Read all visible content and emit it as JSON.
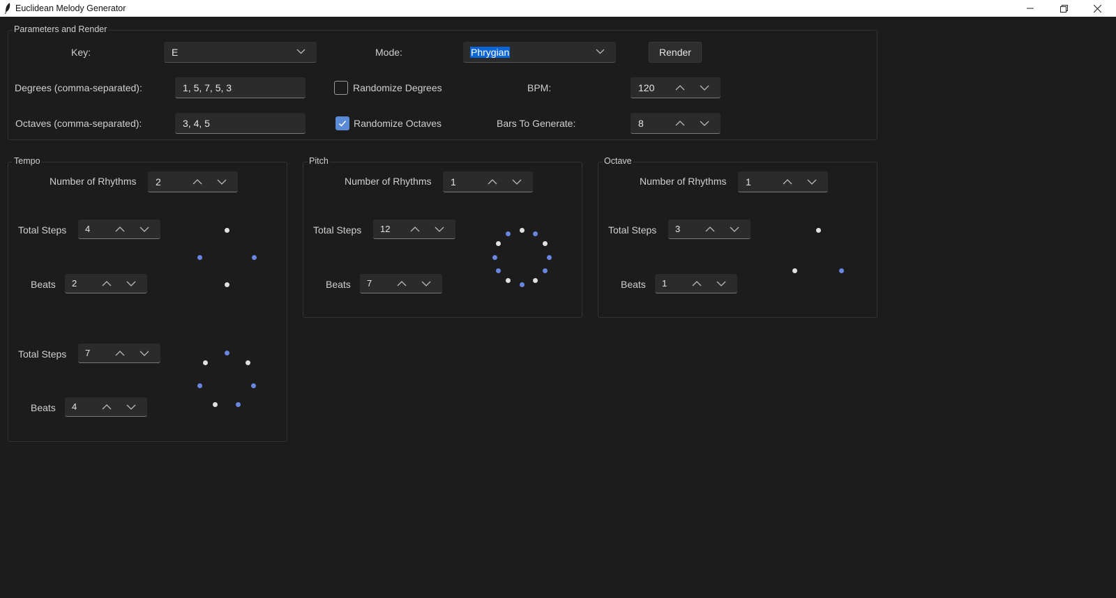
{
  "window": {
    "title": "Euclidean Melody Generator",
    "controls": [
      "minimize",
      "restore",
      "close"
    ]
  },
  "params": {
    "group_title": "Parameters and Render",
    "key_label": "Key:",
    "key_value": "E",
    "mode_label": "Mode:",
    "mode_value": "Phrygian",
    "render_label": "Render",
    "degrees_label": "Degrees (comma-separated):",
    "degrees_value": "1, 5, 7, 5, 3",
    "randomize_degrees_label": "Randomize Degrees",
    "randomize_degrees_checked": false,
    "bpm_label": "BPM:",
    "bpm_value": "120",
    "octaves_label": "Octaves (comma-separated):",
    "octaves_value": "3, 4, 5",
    "randomize_octaves_label": "Randomize Octaves",
    "randomize_octaves_checked": true,
    "bars_label": "Bars To Generate:",
    "bars_value": "8"
  },
  "tempo": {
    "title": "Tempo",
    "num_rhythms_label": "Number of Rhythms",
    "num_rhythms_value": "2",
    "rhythms": [
      {
        "steps_label": "Total Steps",
        "steps_value": "4",
        "beats_label": "Beats",
        "beats_value": "2",
        "pattern": [
          0,
          1,
          0,
          1
        ]
      },
      {
        "steps_label": "Total Steps",
        "steps_value": "7",
        "beats_label": "Beats",
        "beats_value": "4",
        "pattern": [
          1,
          0,
          1,
          1,
          0,
          1,
          0
        ]
      }
    ]
  },
  "pitch": {
    "title": "Pitch",
    "num_rhythms_label": "Number of Rhythms",
    "num_rhythms_value": "1",
    "rhythms": [
      {
        "steps_label": "Total Steps",
        "steps_value": "12",
        "beats_label": "Beats",
        "beats_value": "7",
        "pattern": [
          0,
          1,
          0,
          1,
          1,
          0,
          1,
          0,
          1,
          1,
          0,
          1
        ]
      }
    ]
  },
  "octave": {
    "title": "Octave",
    "num_rhythms_label": "Number of Rhythms",
    "num_rhythms_value": "1",
    "rhythms": [
      {
        "steps_label": "Total Steps",
        "steps_value": "3",
        "beats_label": "Beats",
        "beats_value": "1",
        "pattern": [
          0,
          1,
          0
        ]
      }
    ]
  },
  "colors": {
    "background": "#1c1c1c",
    "active_dot": "#6a86e0",
    "inactive_dot": "#e0e0e0",
    "accent": "#5b8bd6",
    "selection": "#0a64d6"
  }
}
